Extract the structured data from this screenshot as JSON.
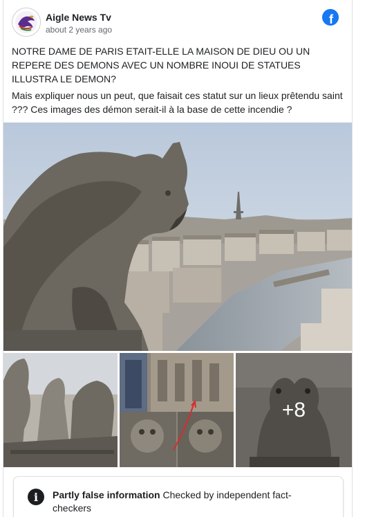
{
  "post": {
    "page_name": "Aigle News Tv",
    "timestamp": "about 2 years ago",
    "paragraph_1": "NOTRE DAME DE PARIS ETAIT-ELLE LA MAISON DE DIEU OU UN REPERE DES DEMONS AVEC UN NOMBRE INOUI DE STATUES ILLUSTRA LE DEMON?",
    "paragraph_2": "Mais expliquer nous un peut, que faisait ces statut sur un lieux prêtendu saint ??? Ces images des démon serait-il à la base de cette incendie ?"
  },
  "photos": {
    "more_count": "+8"
  },
  "fact_check": {
    "title": "Partly false information",
    "text": "Checked by independent fact-checkers"
  },
  "icons": {
    "brand": "facebook-icon",
    "info": "info-icon"
  },
  "colors": {
    "facebook_blue": "#1877f2",
    "text": "#1c1e21",
    "secondary_text": "#65676b"
  }
}
